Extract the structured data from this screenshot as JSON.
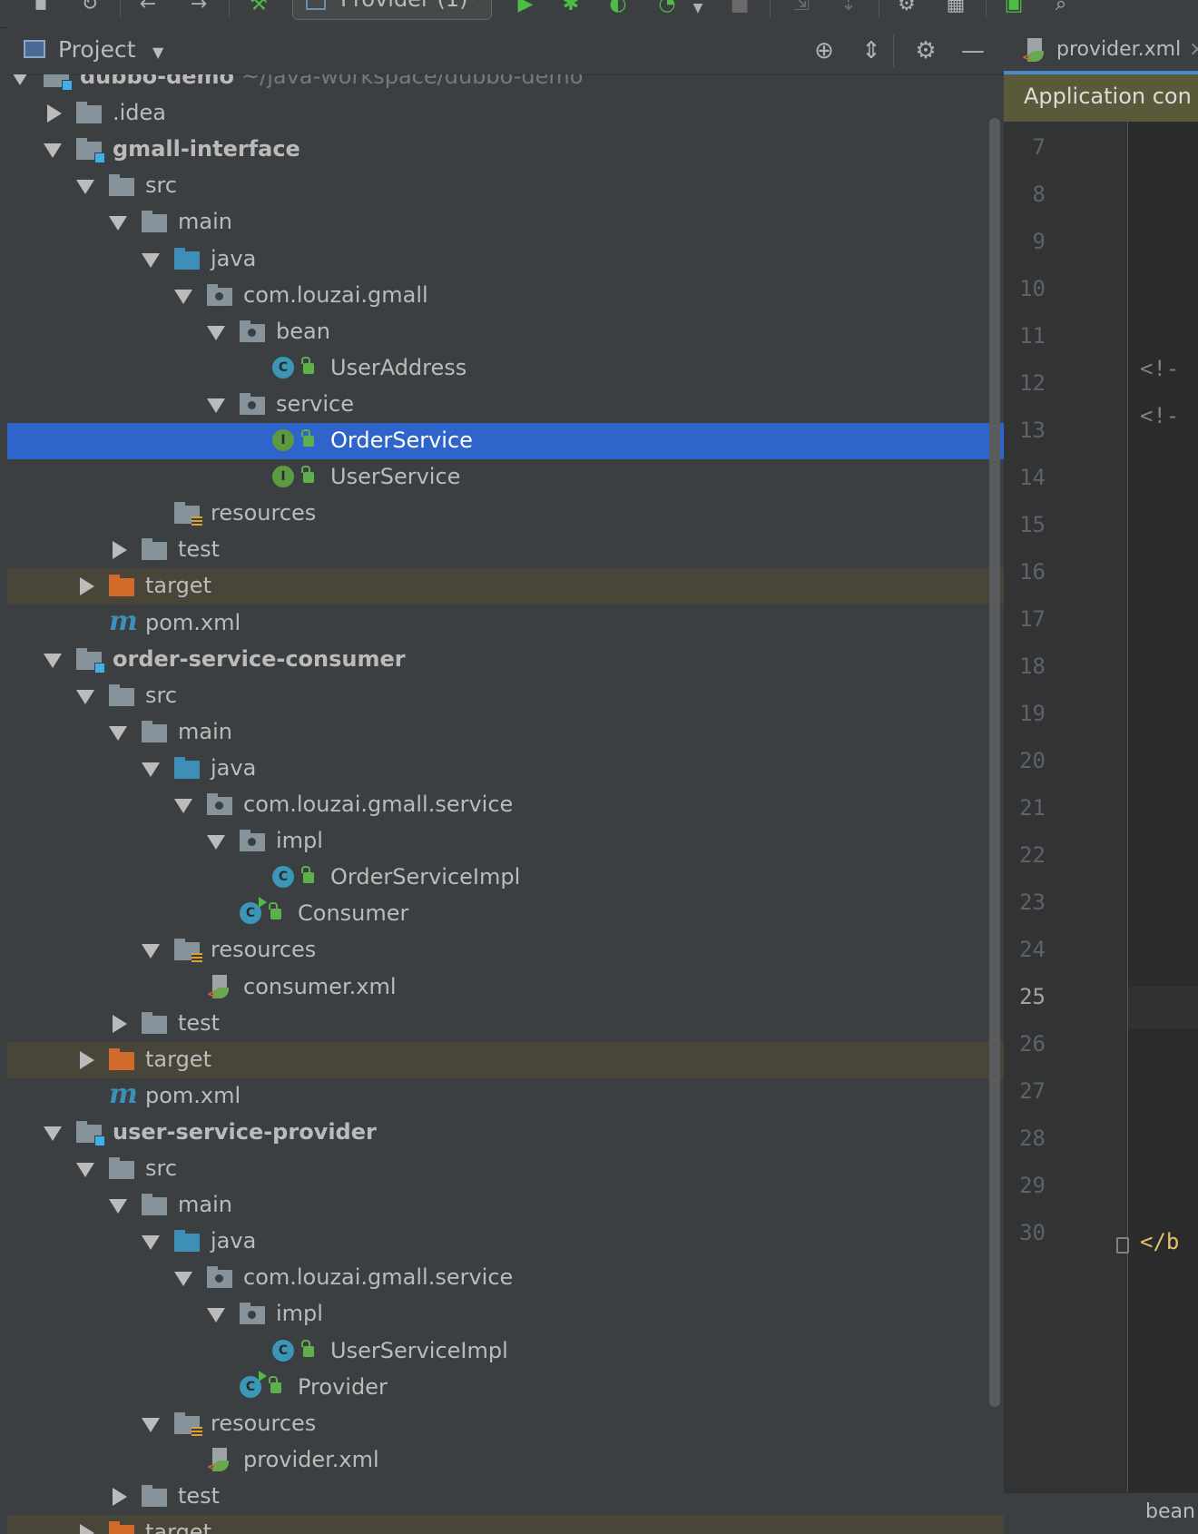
{
  "toolbar": {
    "run_config": "Provider (1)",
    "icons": [
      "save-icon",
      "sync-icon",
      "undo-icon",
      "redo-icon",
      "build-icon",
      "run-icon",
      "debug-icon",
      "coverage-icon",
      "profile-icon",
      "stop-icon",
      "attach-icon",
      "update-icon",
      "wrench-icon",
      "structure-icon",
      "layout-icon",
      "search-icon"
    ]
  },
  "project_panel": {
    "title": "Project",
    "header_icons": [
      "locate-icon",
      "collapse-all-icon",
      "gear-icon",
      "minimize-icon"
    ]
  },
  "tree": [
    {
      "label": "dubbo-demo",
      "path": "~/java-workspace/dubbo-demo",
      "type": "module",
      "expanded": true,
      "bold": true
    },
    {
      "label": ".idea",
      "type": "folder",
      "expanded": false
    },
    {
      "label": "gmall-interface",
      "type": "module",
      "expanded": true,
      "bold": true
    },
    {
      "label": "src",
      "type": "folder",
      "expanded": true
    },
    {
      "label": "main",
      "type": "folder",
      "expanded": true
    },
    {
      "label": "java",
      "type": "source-folder",
      "expanded": true
    },
    {
      "label": "com.louzai.gmall",
      "type": "package",
      "expanded": true
    },
    {
      "label": "bean",
      "type": "package",
      "expanded": true
    },
    {
      "label": "UserAddress",
      "type": "class"
    },
    {
      "label": "service",
      "type": "package",
      "expanded": true
    },
    {
      "label": "OrderService",
      "type": "interface",
      "selected": true
    },
    {
      "label": "UserService",
      "type": "interface"
    },
    {
      "label": "resources",
      "type": "resources"
    },
    {
      "label": "test",
      "type": "folder",
      "expanded": false
    },
    {
      "label": "target",
      "type": "excluded",
      "expanded": false
    },
    {
      "label": "pom.xml",
      "type": "maven"
    },
    {
      "label": "order-service-consumer",
      "type": "module",
      "expanded": true,
      "bold": true
    },
    {
      "label": "src",
      "type": "folder",
      "expanded": true
    },
    {
      "label": "main",
      "type": "folder",
      "expanded": true
    },
    {
      "label": "java",
      "type": "source-folder",
      "expanded": true
    },
    {
      "label": "com.louzai.gmall.service",
      "type": "package",
      "expanded": true
    },
    {
      "label": "impl",
      "type": "package",
      "expanded": true
    },
    {
      "label": "OrderServiceImpl",
      "type": "class"
    },
    {
      "label": "Consumer",
      "type": "main-class"
    },
    {
      "label": "resources",
      "type": "resources",
      "expanded": true
    },
    {
      "label": "consumer.xml",
      "type": "xml"
    },
    {
      "label": "test",
      "type": "folder",
      "expanded": false
    },
    {
      "label": "target",
      "type": "excluded",
      "expanded": false
    },
    {
      "label": "pom.xml",
      "type": "maven"
    },
    {
      "label": "user-service-provider",
      "type": "module",
      "expanded": true,
      "bold": true
    },
    {
      "label": "src",
      "type": "folder",
      "expanded": true
    },
    {
      "label": "main",
      "type": "folder",
      "expanded": true
    },
    {
      "label": "java",
      "type": "source-folder",
      "expanded": true
    },
    {
      "label": "com.louzai.gmall.service",
      "type": "package",
      "expanded": true
    },
    {
      "label": "impl",
      "type": "package",
      "expanded": true
    },
    {
      "label": "UserServiceImpl",
      "type": "class"
    },
    {
      "label": "Provider",
      "type": "main-class"
    },
    {
      "label": "resources",
      "type": "resources",
      "expanded": true
    },
    {
      "label": "provider.xml",
      "type": "xml"
    },
    {
      "label": "test",
      "type": "folder",
      "expanded": false
    },
    {
      "label": "target",
      "type": "excluded",
      "expanded": false
    }
  ],
  "editor": {
    "tab_label": "provider.xml",
    "banner": "Application con",
    "line_numbers": [
      "7",
      "8",
      "9",
      "10",
      "11",
      "12",
      "13",
      "14",
      "15",
      "16",
      "17",
      "18",
      "19",
      "20",
      "21",
      "22",
      "23",
      "24",
      "25",
      "26",
      "27",
      "28",
      "29",
      "30"
    ],
    "current_line": "25",
    "code_line_11": "<!-",
    "code_line_12": "<!-",
    "code_line_30": "</b",
    "status_text": "bean"
  }
}
